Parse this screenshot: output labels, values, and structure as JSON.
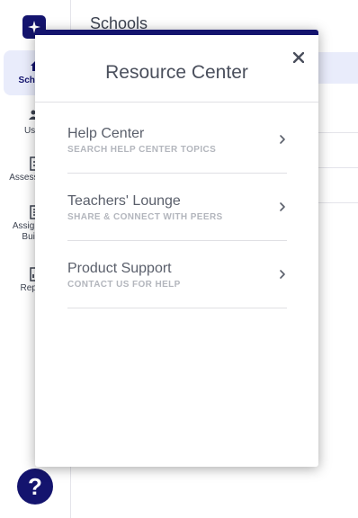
{
  "sidebar": {
    "items": [
      {
        "label": "Schools",
        "icon": "home-icon",
        "active": true
      },
      {
        "label": "Users",
        "icon": "users-icon",
        "active": false
      },
      {
        "label": "Assessments",
        "icon": "assessment-icon",
        "active": false
      },
      {
        "label": "Assignment Builder",
        "icon": "assignment-icon",
        "active": false
      },
      {
        "label": "Reports",
        "icon": "reports-icon",
        "active": false
      }
    ],
    "help_label": "?"
  },
  "main": {
    "title": "Schools"
  },
  "modal": {
    "title": "Resource Center",
    "close_label": "×",
    "items": [
      {
        "title": "Help Center",
        "subtitle": "SEARCH HELP CENTER TOPICS"
      },
      {
        "title": "Teachers' Lounge",
        "subtitle": "SHARE & CONNECT WITH PEERS"
      },
      {
        "title": "Product Support",
        "subtitle": "CONTACT US FOR HELP"
      }
    ]
  },
  "colors": {
    "brand": "#14146e",
    "active_bg": "#e9ecfb",
    "text": "#3d4351",
    "muted": "#b3b6bd"
  }
}
